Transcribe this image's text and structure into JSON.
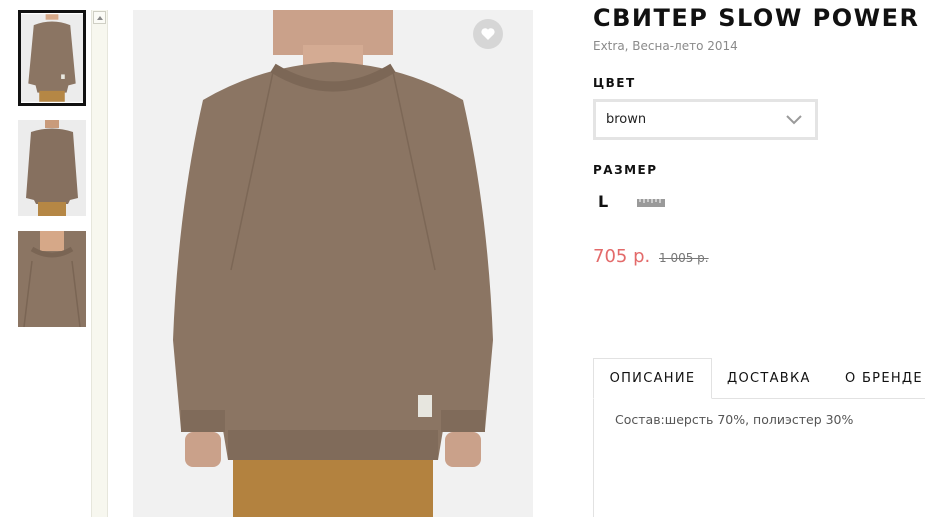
{
  "product": {
    "title": "СВИТЕР SLOW POWER",
    "subtitle": "Extra, Весна-лето 2014",
    "color_label": "ЦВЕТ",
    "color_value": "brown",
    "size_label": "РАЗМЕР",
    "size_value": "L",
    "price": "705 р.",
    "old_price": "1 005 р."
  },
  "tabs": [
    {
      "label": "ОПИСАНИЕ",
      "active": true
    },
    {
      "label": "ДОСТАВКА",
      "active": false
    },
    {
      "label": "О БРЕНДЕ",
      "active": false
    }
  ],
  "description": "Состав:шерсть 70%, полиэстер 30%",
  "icons": {
    "favorite": "heart-icon",
    "dropdown": "chevron-down-icon",
    "size_guide": "ruler-icon"
  },
  "colors": {
    "sweater": "#8b7563",
    "price": "#e36a6a",
    "favorite_bg": "#d6d6d6"
  }
}
